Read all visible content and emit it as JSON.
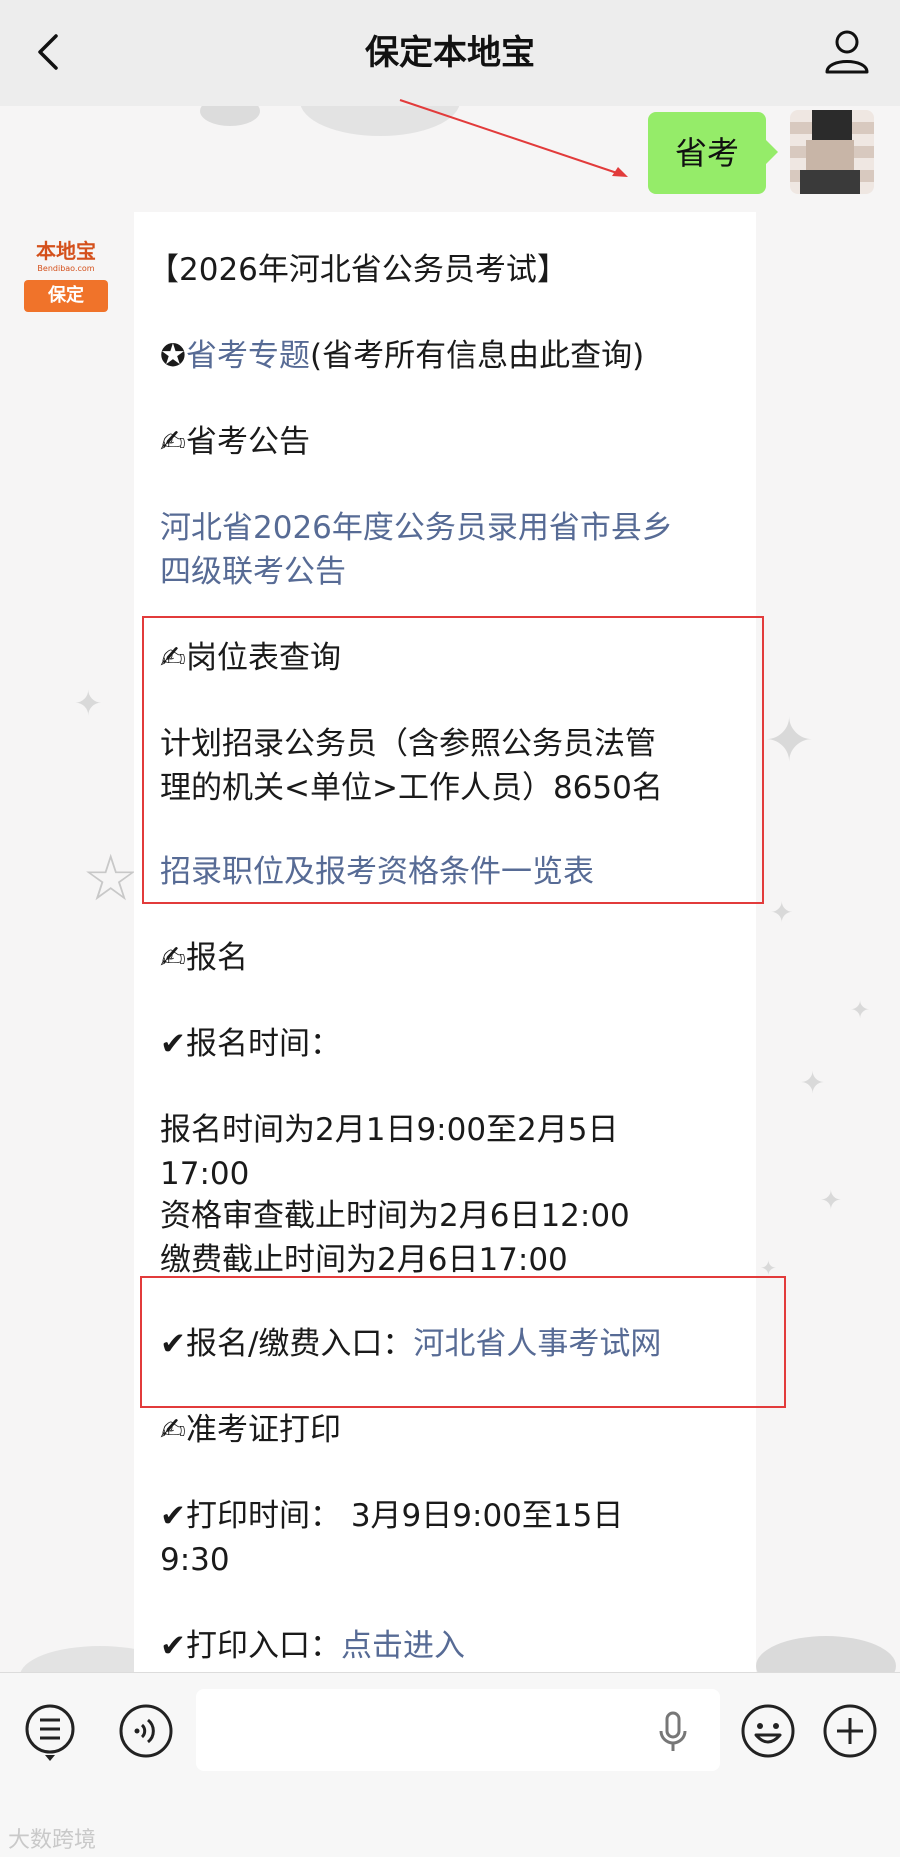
{
  "header": {
    "title": "保定本地宝",
    "back_icon": "chevron-left-icon",
    "profile_icon": "person-icon"
  },
  "outgoing_message": {
    "text": "省考"
  },
  "sender_logo": {
    "top": "本地宝",
    "sub": "Bendibao.com",
    "bottom": "保定"
  },
  "message": {
    "heading": "【2026年河北省公务员考试】",
    "topic_prefix": "✪",
    "topic_link": "省考专题",
    "topic_suffix": "(省考所有信息由此查询)",
    "announcement_title": "✍省考公告",
    "announcement_link_line1": "河北省2026年度公务员录用省市县乡",
    "announcement_link_line2": "四级联考公告",
    "positions_title": "✍岗位表查询",
    "positions_desc_line1": "计划招录公务员（含参照公务员法管",
    "positions_desc_line2": "理的机关<单位>工作人员）8650名",
    "positions_link": "招录职位及报考资格条件一览表",
    "signup_title": "✍报名",
    "signup_time_label": "✔报名时间：",
    "signup_time_line1": "报名时间为2月1日9:00至2月5日",
    "signup_time_line2": "17:00",
    "review_deadline": "资格审查截止时间为2月6日12:00",
    "payment_deadline": "缴费截止时间为2月6日17:00",
    "entry_label": "✔报名/缴费入口：",
    "entry_link": "河北省人事考试网",
    "admit_title": "✍准考证打印",
    "print_time_line1": "✔打印时间：  3月9日9:00至15日",
    "print_time_line2": "9:30",
    "print_entry_label": "✔打印入口：",
    "print_entry_link": "点击进入"
  },
  "bottom_bar": {
    "menu_icon": "list-menu-icon",
    "voice_icon": "voice-icon",
    "mic_icon": "microphone-icon",
    "emoji_icon": "emoji-icon",
    "plus_icon": "plus-icon"
  },
  "watermark": "大数跨境",
  "colors": {
    "link": "#576b95",
    "bubble_out": "#95ec69",
    "highlight_box": "#e23b3b"
  }
}
